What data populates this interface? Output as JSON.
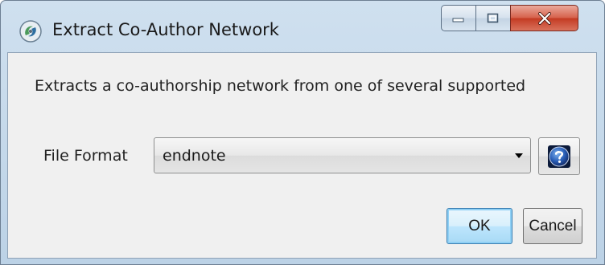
{
  "window": {
    "title": "Extract Co-Author Network",
    "app_icon": "app-logo-icon",
    "controls": {
      "minimize_icon": "minimize-icon",
      "maximize_icon": "maximize-icon",
      "close_icon": "close-icon"
    }
  },
  "dialog": {
    "description": "Extracts a co-authorship network from one of several supported",
    "file_format": {
      "label": "File Format",
      "selected_value": "endnote",
      "dropdown_icon": "chevron-down-icon"
    },
    "help_icon": "help-icon",
    "buttons": {
      "ok_label": "OK",
      "cancel_label": "Cancel"
    }
  },
  "colors": {
    "titlebar": "#c6d8ea",
    "client_background": "#f0f0f0",
    "close_button": "#c8442c",
    "ok_button_accent": "#3c7fb1",
    "help_icon": "#1f4e9c"
  }
}
